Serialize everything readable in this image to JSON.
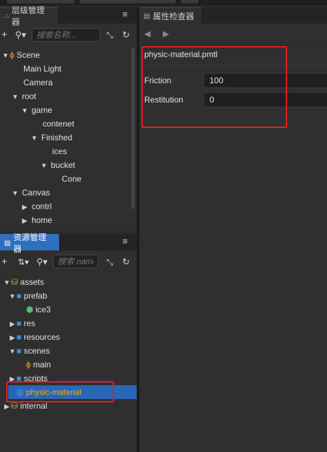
{
  "hierarchy": {
    "tab_label": "层级管理器",
    "search_placeholder": "搜索名称...",
    "items": [
      {
        "label": "Scene",
        "arrow": "▼",
        "icon": "scene"
      },
      {
        "label": "Main Light",
        "arrow": "",
        "icon": ""
      },
      {
        "label": "Camera",
        "arrow": "",
        "icon": ""
      },
      {
        "label": "root",
        "arrow": "▼",
        "icon": ""
      },
      {
        "label": "game",
        "arrow": "▼",
        "icon": ""
      },
      {
        "label": "contenet",
        "arrow": "",
        "icon": ""
      },
      {
        "label": "Finished",
        "arrow": "▼",
        "icon": ""
      },
      {
        "label": "ices",
        "arrow": "",
        "icon": ""
      },
      {
        "label": "bucket",
        "arrow": "▼",
        "icon": ""
      },
      {
        "label": "Cone",
        "arrow": "",
        "icon": ""
      },
      {
        "label": "Canvas",
        "arrow": "▼",
        "icon": ""
      },
      {
        "label": "contrl",
        "arrow": "▶",
        "icon": ""
      },
      {
        "label": "home",
        "arrow": "▶",
        "icon": ""
      }
    ]
  },
  "assets": {
    "tab_label": "资源管理器",
    "search_placeholder": "搜索 name",
    "items": [
      {
        "label": "assets",
        "arrow": "▼",
        "icon": "database"
      },
      {
        "label": "prefab",
        "arrow": "▼",
        "icon": "folder"
      },
      {
        "label": "ice3",
        "arrow": "",
        "icon": "prefab"
      },
      {
        "label": "res",
        "arrow": "▶",
        "icon": "folder"
      },
      {
        "label": "resources",
        "arrow": "▶",
        "icon": "folder"
      },
      {
        "label": "scenes",
        "arrow": "▼",
        "icon": "folder"
      },
      {
        "label": "main",
        "arrow": "",
        "icon": "scene"
      },
      {
        "label": "scripts",
        "arrow": "▶",
        "icon": "folder"
      },
      {
        "label": "physic-material",
        "arrow": "",
        "icon": "physic-material",
        "selected": true
      },
      {
        "label": "internal",
        "arrow": "▶",
        "icon": "database"
      }
    ]
  },
  "inspector": {
    "tab_label": "属性检查器",
    "file_name": "physic-material.pmtl",
    "properties": [
      {
        "label": "Friction",
        "value": "100"
      },
      {
        "label": "Restitution",
        "value": "0"
      }
    ]
  },
  "colors": {
    "accent": "#2f6fbf",
    "selection": "#2a66b8",
    "highlight_text": "#f5a623",
    "annotation": "#e02020",
    "folder": "#3b8fe0",
    "scene_icon": "#f0a020",
    "prefab_icon": "#4cc36a",
    "db_icon": "#e0b040"
  }
}
